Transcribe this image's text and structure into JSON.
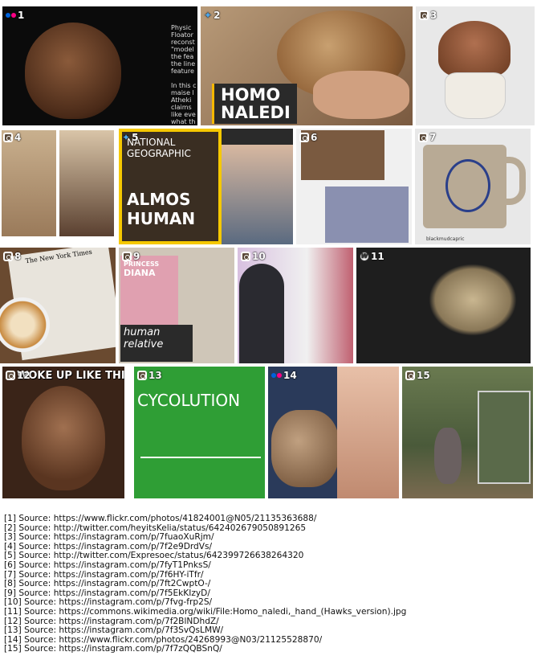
{
  "tiles": [
    {
      "num": "1",
      "source_icon": "flickr-icon",
      "overlay_text": "Physic\nFloator\nreconst\n\"model\nthe fea\nthe line\nfeature\n\nIn this c\nmaise l\nAtheki\nclaims\nlike eve\nwhat th\nhair/fur"
    },
    {
      "num": "2",
      "source_icon": "twitter-icon",
      "overlay_line1": "HOMO",
      "overlay_line2": "NALEDI"
    },
    {
      "num": "3",
      "source_icon": "instagram-icon"
    },
    {
      "num": "4",
      "source_icon": "instagram-icon"
    },
    {
      "num": "5",
      "source_icon": "twitter-icon",
      "magazine_line1": "NATIONAL",
      "magazine_line2": "GEOGRAPHIC",
      "magazine_line3": "ALMOS",
      "magazine_line4": "HUMAN"
    },
    {
      "num": "6",
      "source_icon": "instagram-icon"
    },
    {
      "num": "7",
      "source_icon": "instagram-icon",
      "caption": "blackmudcapric"
    },
    {
      "num": "8",
      "source_icon": "instagram-icon",
      "newspaper_title": "The New York Times"
    },
    {
      "num": "9",
      "source_icon": "instagram-icon",
      "mag_text1": "PRINCESS",
      "mag_text2": "DIANA",
      "mag_text3": "human",
      "mag_text4": "relative"
    },
    {
      "num": "10",
      "source_icon": "instagram-icon"
    },
    {
      "num": "11",
      "source_icon": "wikimedia-icon"
    },
    {
      "num": "12",
      "source_icon": "instagram-icon",
      "meme_text": "WOKE UP LIKE THIS"
    },
    {
      "num": "13",
      "source_icon": "instagram-icon",
      "shirt_text": "CYCOLUTION"
    },
    {
      "num": "14",
      "source_icon": "flickr-icon"
    },
    {
      "num": "15",
      "source_icon": "instagram-icon"
    }
  ],
  "sources": [
    "[1] Source: https://www.flickr.com/photos/41824001@N05/21135363688/",
    "[2] Source: http://twitter.com/heyitsKelia/status/642402679050891265",
    "[3] Source: https://instagram.com/p/7fuaoXuRjm/",
    "[4] Source: https://instagram.com/p/7f2e9DrdVs/",
    "[5] Source: http://twitter.com/Expresoec/status/642399726638264320",
    "[6] Source: https://instagram.com/p/7fyT1PnksS/",
    "[7] Source: https://instagram.com/p/7f6HY-iTfr/",
    "[8] Source: https://instagram.com/p/7ft2CwptO-/",
    "[9] Source: https://instagram.com/p/7f5EkKIzyD/",
    "[10] Source: https://instagram.com/p/7fvg-frp2S/",
    "[11] Source: https://commons.wikimedia.org/wiki/File:Homo_naledi,_hand_(Hawks_version).jpg",
    "[12] Source: https://instagram.com/p/7f2BlNDhdZ/",
    "[13] Source: https://instagram.com/p/7f3SvQsLMW/",
    "[14] Source: https://www.flickr.com/photos/24268993@N03/21125528870/",
    "[15] Source: https://instagram.com/p/7f7zQQBSnQ/"
  ]
}
